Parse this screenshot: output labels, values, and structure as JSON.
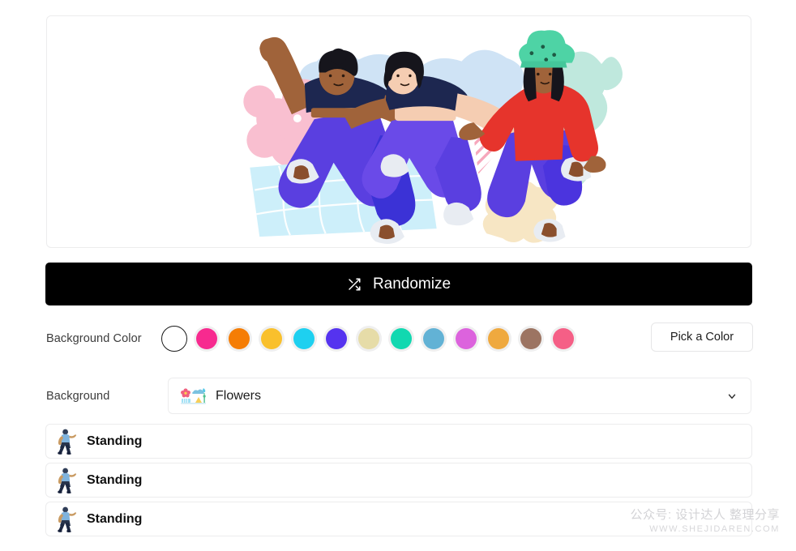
{
  "preview": {
    "alt": "three people jumping illustration",
    "background_scene": "flowers-and-abstract-shapes"
  },
  "randomize": {
    "label": "Randomize",
    "icon": "shuffle-icon",
    "background_color": "#000000",
    "text_color": "#ffffff"
  },
  "background_color": {
    "label": "Background Color",
    "selected_index": 0,
    "swatches": [
      {
        "name": "white",
        "hex": "#ffffff",
        "selected": true
      },
      {
        "name": "pink",
        "hex": "#f72a8f"
      },
      {
        "name": "orange",
        "hex": "#f57d05"
      },
      {
        "name": "amber",
        "hex": "#f9c02c"
      },
      {
        "name": "cyan",
        "hex": "#1ed0f0"
      },
      {
        "name": "indigo",
        "hex": "#5533ef"
      },
      {
        "name": "sand",
        "hex": "#e6dca8"
      },
      {
        "name": "teal",
        "hex": "#11d8b0"
      },
      {
        "name": "steel-blue",
        "hex": "#62b2d5"
      },
      {
        "name": "orchid",
        "hex": "#dc63dd"
      },
      {
        "name": "tangerine",
        "hex": "#efa93f"
      },
      {
        "name": "brown",
        "hex": "#9c7462"
      },
      {
        "name": "rose",
        "hex": "#f55f86"
      }
    ],
    "pick_button_label": "Pick a Color"
  },
  "background_select": {
    "label": "Background",
    "value": "Flowers",
    "icon": "flowers-scene-icon",
    "chevron": "chevron-down-icon"
  },
  "options": [
    {
      "icon": "standing-person-icon",
      "label": "Standing"
    },
    {
      "icon": "standing-person-icon",
      "label": "Standing"
    },
    {
      "icon": "standing-person-icon",
      "label": "Standing"
    }
  ],
  "watermark": {
    "line1": "公众号: 设计达人 整理分享",
    "line2": "WWW.SHEJIDAREN.COM"
  }
}
